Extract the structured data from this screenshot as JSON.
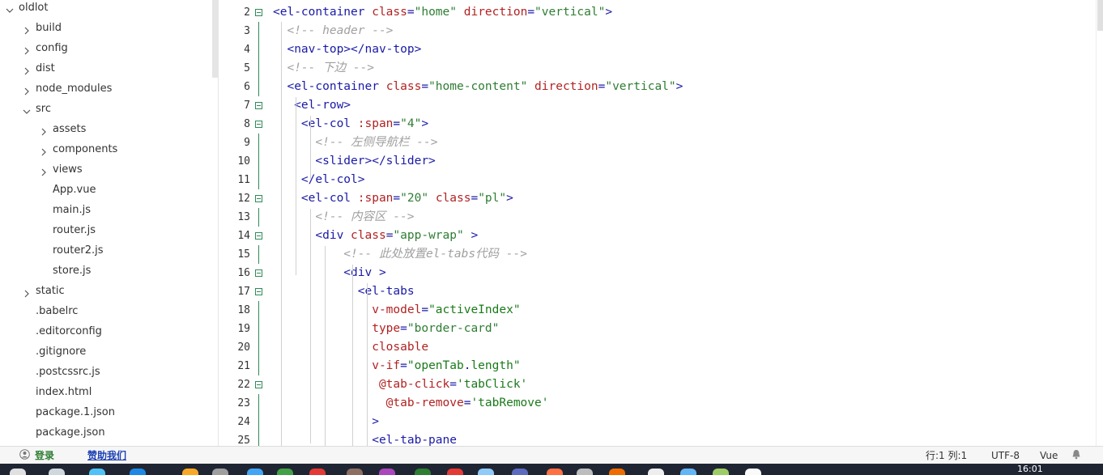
{
  "sidebar": {
    "items": [
      {
        "label": "oldlot",
        "level": 0,
        "chevron": "down"
      },
      {
        "label": "build",
        "level": 1,
        "chevron": "right"
      },
      {
        "label": "config",
        "level": 1,
        "chevron": "right"
      },
      {
        "label": "dist",
        "level": 1,
        "chevron": "right"
      },
      {
        "label": "node_modules",
        "level": 1,
        "chevron": "right"
      },
      {
        "label": "src",
        "level": 1,
        "chevron": "down"
      },
      {
        "label": "assets",
        "level": 2,
        "chevron": "right"
      },
      {
        "label": "components",
        "level": 2,
        "chevron": "right"
      },
      {
        "label": "views",
        "level": 2,
        "chevron": "right"
      },
      {
        "label": "App.vue",
        "level": 2,
        "chevron": "none"
      },
      {
        "label": "main.js",
        "level": 2,
        "chevron": "none"
      },
      {
        "label": "router.js",
        "level": 2,
        "chevron": "none"
      },
      {
        "label": "router2.js",
        "level": 2,
        "chevron": "none"
      },
      {
        "label": "store.js",
        "level": 2,
        "chevron": "none"
      },
      {
        "label": "static",
        "level": 1,
        "chevron": "right"
      },
      {
        "label": ".babelrc",
        "level": 1,
        "chevron": "none"
      },
      {
        "label": ".editorconfig",
        "level": 1,
        "chevron": "none"
      },
      {
        "label": ".gitignore",
        "level": 1,
        "chevron": "none"
      },
      {
        "label": ".postcssrc.js",
        "level": 1,
        "chevron": "none"
      },
      {
        "label": "index.html",
        "level": 1,
        "chevron": "none"
      },
      {
        "label": "package.1.json",
        "level": 1,
        "chevron": "none"
      },
      {
        "label": "package.json",
        "level": 1,
        "chevron": "none"
      }
    ]
  },
  "editor": {
    "lines": [
      {
        "num": "2",
        "fold": true,
        "tokens": [
          [
            "tag",
            "<el-container "
          ],
          [
            "attr",
            "class"
          ],
          [
            "punct",
            "="
          ],
          [
            "str",
            "\"home\""
          ],
          [
            "punct",
            " "
          ],
          [
            "attr",
            "direction"
          ],
          [
            "punct",
            "="
          ],
          [
            "str",
            "\"vertical\""
          ],
          [
            "tag",
            ">"
          ]
        ]
      },
      {
        "num": "3",
        "fold": false,
        "tokens": [
          [
            "cmt",
            "  <!-- header -->"
          ]
        ]
      },
      {
        "num": "4",
        "fold": false,
        "tokens": [
          [
            "tag",
            "  <nav-top></nav-top>"
          ]
        ]
      },
      {
        "num": "5",
        "fold": false,
        "tokens": [
          [
            "cmt",
            "  <!-- 下边 -->"
          ]
        ]
      },
      {
        "num": "6",
        "fold": false,
        "tokens": [
          [
            "tag",
            "  <el-container "
          ],
          [
            "attr",
            "class"
          ],
          [
            "punct",
            "="
          ],
          [
            "str",
            "\"home-content\""
          ],
          [
            "punct",
            " "
          ],
          [
            "attr",
            "direction"
          ],
          [
            "punct",
            "="
          ],
          [
            "str",
            "\"vertical\""
          ],
          [
            "tag",
            ">"
          ]
        ]
      },
      {
        "num": "7",
        "fold": true,
        "tokens": [
          [
            "tag",
            "   <el-row>"
          ]
        ]
      },
      {
        "num": "8",
        "fold": true,
        "tokens": [
          [
            "tag",
            "    <el-col "
          ],
          [
            "attr",
            ":span"
          ],
          [
            "punct",
            "="
          ],
          [
            "str",
            "\"4\""
          ],
          [
            "tag",
            ">"
          ]
        ]
      },
      {
        "num": "9",
        "fold": false,
        "tokens": [
          [
            "cmt",
            "      <!-- 左侧导航栏 -->"
          ]
        ]
      },
      {
        "num": "10",
        "fold": false,
        "tokens": [
          [
            "tag",
            "      <slider></slider>"
          ]
        ]
      },
      {
        "num": "11",
        "fold": false,
        "tokens": [
          [
            "tag",
            "    </el-col>"
          ]
        ]
      },
      {
        "num": "12",
        "fold": true,
        "tokens": [
          [
            "tag",
            "    <el-col "
          ],
          [
            "attr",
            ":span"
          ],
          [
            "punct",
            "="
          ],
          [
            "str",
            "\"20\""
          ],
          [
            "punct",
            " "
          ],
          [
            "attr",
            "class"
          ],
          [
            "punct",
            "="
          ],
          [
            "str",
            "\"pl\""
          ],
          [
            "tag",
            ">"
          ]
        ]
      },
      {
        "num": "13",
        "fold": false,
        "tokens": [
          [
            "cmt",
            "      <!-- 内容区 -->"
          ]
        ]
      },
      {
        "num": "14",
        "fold": true,
        "tokens": [
          [
            "tag",
            "      <div "
          ],
          [
            "attr",
            "class"
          ],
          [
            "punct",
            "="
          ],
          [
            "str",
            "\"app-wrap\""
          ],
          [
            "tag",
            " >"
          ]
        ]
      },
      {
        "num": "15",
        "fold": false,
        "tokens": [
          [
            "cmt",
            "          <!-- 此处放置el-tabs代码 -->"
          ]
        ]
      },
      {
        "num": "16",
        "fold": true,
        "tokens": [
          [
            "tag",
            "          <div >"
          ]
        ]
      },
      {
        "num": "17",
        "fold": true,
        "tokens": [
          [
            "tag",
            "            <el-tabs"
          ]
        ]
      },
      {
        "num": "18",
        "fold": false,
        "tokens": [
          [
            "attr",
            "              v-model"
          ],
          [
            "punct",
            "="
          ],
          [
            "str2",
            "\"activeIndex\""
          ]
        ]
      },
      {
        "num": "19",
        "fold": false,
        "tokens": [
          [
            "attr",
            "              type"
          ],
          [
            "punct",
            "="
          ],
          [
            "str",
            "\"border-card\""
          ]
        ]
      },
      {
        "num": "20",
        "fold": false,
        "tokens": [
          [
            "attr",
            "              closable"
          ]
        ]
      },
      {
        "num": "21",
        "fold": false,
        "tokens": [
          [
            "attr",
            "              v-if"
          ],
          [
            "punct",
            "="
          ],
          [
            "str2",
            "\"openTab"
          ],
          [
            "tag",
            "."
          ],
          [
            "str2",
            "length\""
          ]
        ]
      },
      {
        "num": "22",
        "fold": true,
        "tokens": [
          [
            "attr",
            "               @tab-click"
          ],
          [
            "punct",
            "="
          ],
          [
            "str2",
            "'tabClick'"
          ]
        ]
      },
      {
        "num": "23",
        "fold": false,
        "tokens": [
          [
            "attr",
            "                @tab-remove"
          ],
          [
            "punct",
            "="
          ],
          [
            "str2",
            "'tabRemove'"
          ]
        ]
      },
      {
        "num": "24",
        "fold": false,
        "tokens": [
          [
            "tag",
            "              >"
          ]
        ]
      },
      {
        "num": "25",
        "fold": false,
        "tokens": [
          [
            "tag",
            "              <el-tab-pane"
          ]
        ]
      }
    ]
  },
  "statusbar": {
    "login": "登录",
    "sponsor": "赞助我们",
    "position": "行:1   列:1",
    "encoding": "UTF-8",
    "language": "Vue"
  },
  "taskbar": {
    "time": "16:01"
  },
  "colors": {
    "tag": "#1a1aa6",
    "attr": "#b22222",
    "string": "#2e7d32",
    "comment": "#a0a0a0",
    "fold": "#2e8b57"
  }
}
